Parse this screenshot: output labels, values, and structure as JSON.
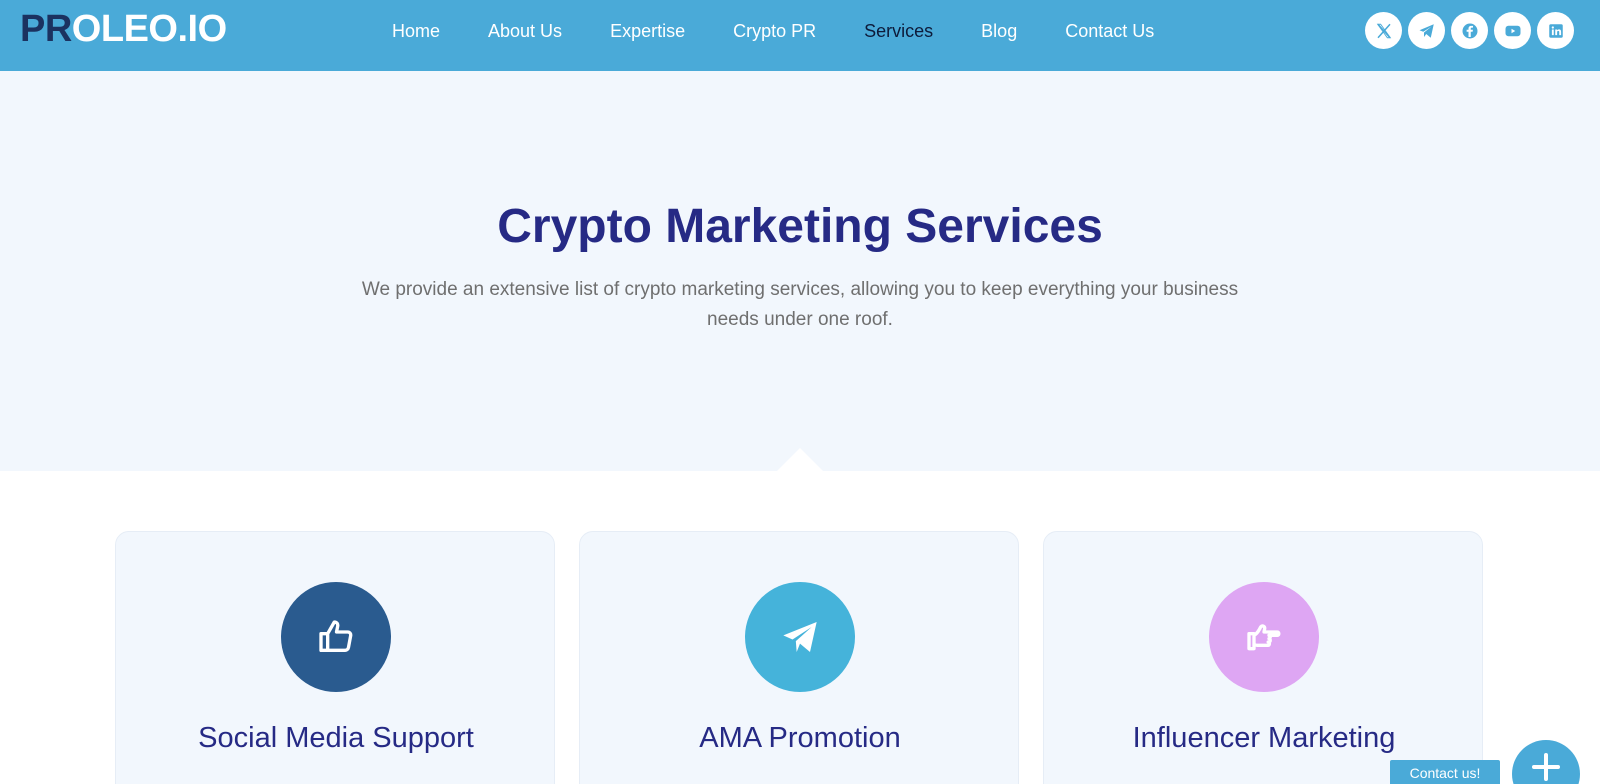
{
  "brand": {
    "logo_prefix": "PR",
    "logo_rest": "OLEO.IO"
  },
  "nav": {
    "items": [
      {
        "label": "Home"
      },
      {
        "label": "About Us"
      },
      {
        "label": "Expertise"
      },
      {
        "label": "Crypto PR"
      },
      {
        "label": "Services",
        "active": true
      },
      {
        "label": "Blog"
      },
      {
        "label": "Contact Us"
      }
    ]
  },
  "socials": [
    "x-icon",
    "telegram-icon",
    "facebook-icon",
    "youtube-icon",
    "linkedin-icon"
  ],
  "hero": {
    "title": "Crypto Marketing Services",
    "subtitle": "We provide an extensive list of crypto marketing services, allowing you to keep everything your business needs under one roof."
  },
  "cards": [
    {
      "title": "Social Media Support",
      "icon": "thumbs-up-icon",
      "color": "#2a5b8f"
    },
    {
      "title": "AMA Promotion",
      "icon": "paper-plane-icon",
      "color": "#45b3da"
    },
    {
      "title": "Influencer Marketing",
      "icon": "pointing-hand-icon",
      "color": "#dea6f3"
    }
  ],
  "floating": {
    "contact_label": "Contact us!"
  },
  "colors": {
    "header": "#4aaad8",
    "title": "#262a85",
    "hero_bg": "#f2f7fd"
  }
}
